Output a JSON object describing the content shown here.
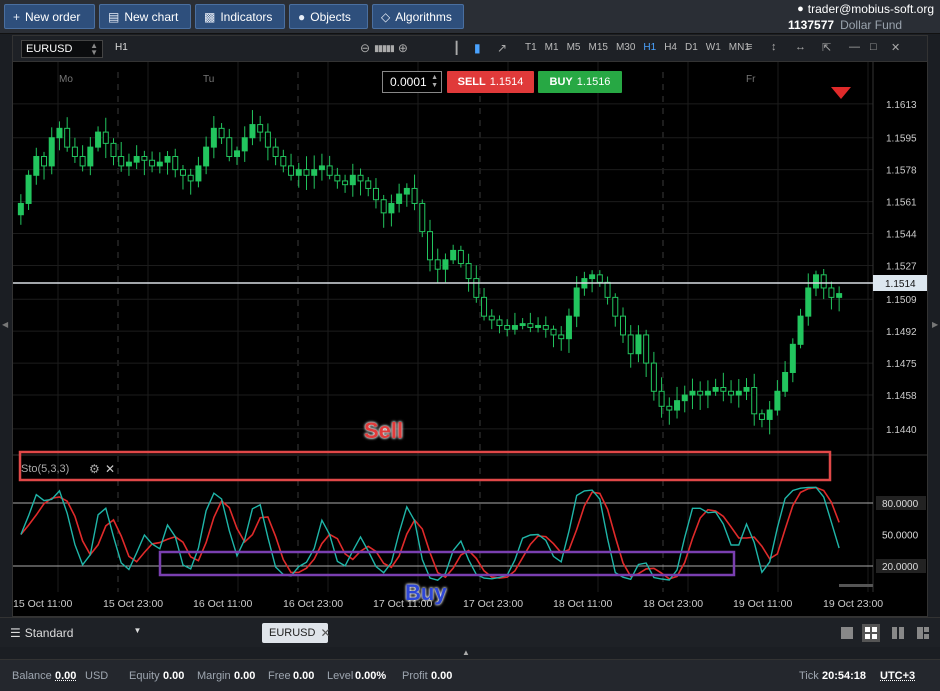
{
  "toolbar": {
    "new_order": "New order",
    "new_chart": "New chart",
    "indicators": "Indicators",
    "objects": "Objects",
    "algorithms": "Algorithms"
  },
  "account": {
    "email": "trader@mobius-soft.org",
    "number": "1137577",
    "name": "Dollar Fund"
  },
  "chart": {
    "symbol": "EURUSD",
    "timeframe": "H1",
    "timeframes": [
      "T1",
      "M1",
      "M5",
      "M15",
      "M30",
      "H1",
      "H4",
      "D1",
      "W1",
      "MN1"
    ],
    "active_timeframe": "H1",
    "lot": "0.0001",
    "sell_label": "SELL",
    "sell_price": "1.1514",
    "buy_label": "BUY",
    "buy_price": "1.1516",
    "current_price": "1.1514",
    "day_labels": [
      "Mo",
      "Tu",
      "Fr"
    ],
    "indicator_label": "Sto(5,3,3)",
    "colors": {
      "bull": "#22c55e",
      "bear": "#22c55e",
      "k_line": "#1fb5a8",
      "d_line": "#e02a2a",
      "sell_box": "#e04848",
      "buy_box": "#7a3fb0"
    }
  },
  "chart_data": {
    "type": "candlestick",
    "price_axis_ticks": [
      "1.1613",
      "1.1595",
      "1.1578",
      "1.1561",
      "1.1544",
      "1.1527",
      "1.1509",
      "1.1492",
      "1.1475",
      "1.1458",
      "1.1440"
    ],
    "price_ylim": [
      1.1425,
      1.163
    ],
    "time_axis_ticks": [
      "15 Oct 11:00",
      "15 Oct 23:00",
      "16 Oct 11:00",
      "16 Oct 23:00",
      "17 Oct 11:00",
      "17 Oct 23:00",
      "18 Oct 11:00",
      "18 Oct 23:00",
      "19 Oct 11:00",
      "19 Oct 23:00"
    ],
    "close_series": [
      1.156,
      1.1575,
      1.1585,
      1.158,
      1.1595,
      1.16,
      1.159,
      1.1585,
      1.158,
      1.159,
      1.1598,
      1.1592,
      1.1585,
      1.158,
      1.1582,
      1.1585,
      1.1583,
      1.158,
      1.1582,
      1.1585,
      1.1578,
      1.1575,
      1.1572,
      1.158,
      1.159,
      1.16,
      1.1595,
      1.1585,
      1.1588,
      1.1595,
      1.1602,
      1.1598,
      1.159,
      1.1585,
      1.158,
      1.1575,
      1.1578,
      1.1575,
      1.1578,
      1.158,
      1.1575,
      1.1572,
      1.157,
      1.1575,
      1.1572,
      1.1568,
      1.1562,
      1.1555,
      1.156,
      1.1565,
      1.1568,
      1.156,
      1.1545,
      1.153,
      1.1525,
      1.153,
      1.1535,
      1.1528,
      1.152,
      1.151,
      1.15,
      1.1498,
      1.1495,
      1.1493,
      1.1495,
      1.1496,
      1.1494,
      1.1495,
      1.1493,
      1.149,
      1.1488,
      1.15,
      1.1515,
      1.152,
      1.1522,
      1.1518,
      1.151,
      1.15,
      1.149,
      1.148,
      1.149,
      1.1475,
      1.146,
      1.1452,
      1.145,
      1.1455,
      1.1458,
      1.146,
      1.1458,
      1.146,
      1.1462,
      1.146,
      1.1458,
      1.146,
      1.1462,
      1.1448,
      1.1445,
      1.145,
      1.146,
      1.147,
      1.1485,
      1.15,
      1.1515,
      1.1522,
      1.1515,
      1.151,
      1.1512
    ],
    "stochastic": {
      "levels": [
        "80.0000",
        "50.0000",
        "20.0000"
      ],
      "ylim": [
        0,
        100
      ]
    }
  },
  "annotations": {
    "sell": "Sell",
    "buy": "Buy"
  },
  "bottom": {
    "workspace": "Standard",
    "tab": "EURUSD"
  },
  "status": {
    "balance_label": "Balance",
    "balance": "0.00",
    "balance_ccy": "USD",
    "equity_label": "Equity",
    "equity": "0.00",
    "margin_label": "Margin",
    "margin": "0.00",
    "free_label": "Free",
    "free": "0.00",
    "level_label": "Level",
    "level": "0.00%",
    "profit_label": "Profit",
    "profit": "0.00",
    "tick_label": "Tick",
    "time": "20:54:18",
    "tz": "UTC+3"
  }
}
